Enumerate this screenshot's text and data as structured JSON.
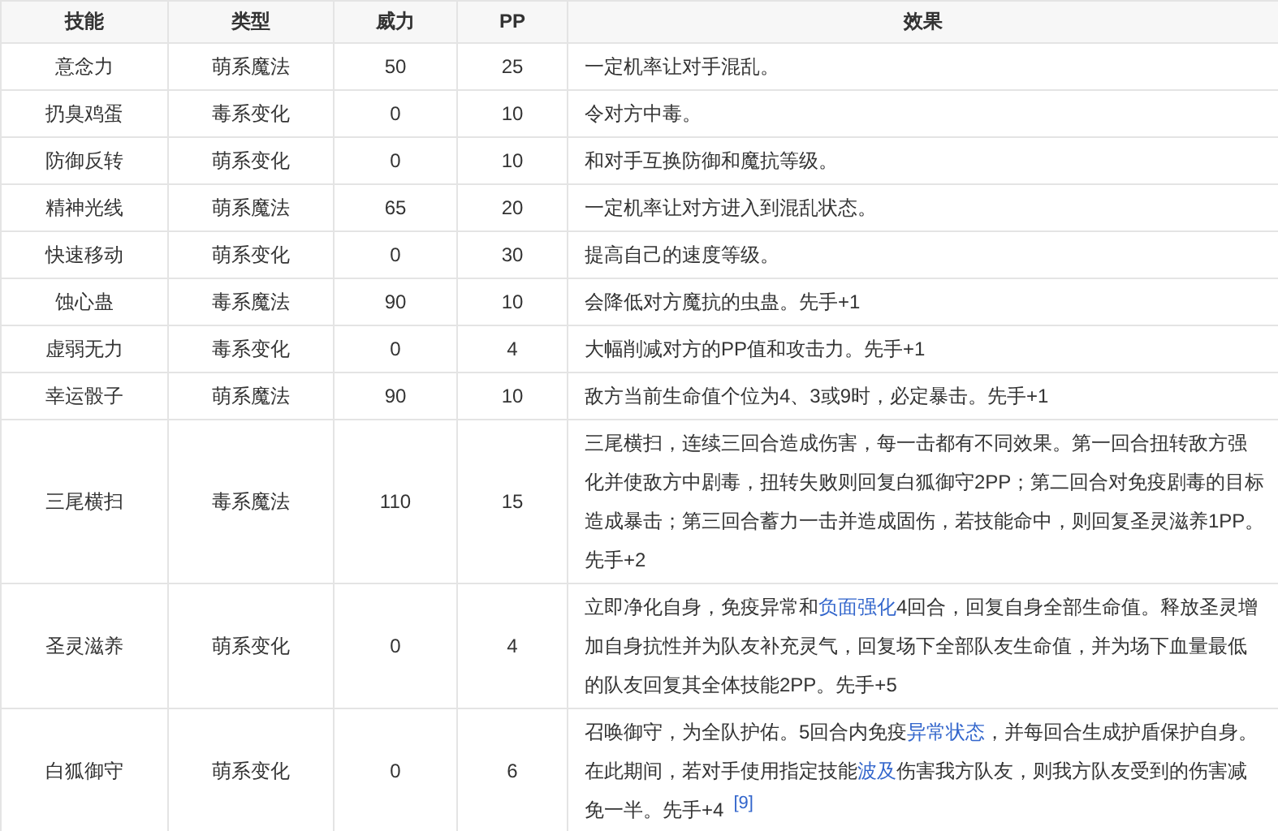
{
  "table": {
    "columns": [
      "技能",
      "类型",
      "威力",
      "PP",
      "效果"
    ],
    "rows": [
      {
        "cells": [
          "意念力",
          "萌系魔法",
          "50",
          "25"
        ],
        "effect": [
          {
            "kind": "text",
            "text": "一定机率让对手混乱。"
          }
        ]
      },
      {
        "cells": [
          "扔臭鸡蛋",
          "毒系变化",
          "0",
          "10"
        ],
        "effect": [
          {
            "kind": "text",
            "text": "令对方中毒。"
          }
        ]
      },
      {
        "cells": [
          "防御反转",
          "萌系变化",
          "0",
          "10"
        ],
        "effect": [
          {
            "kind": "text",
            "text": "和对手互换防御和魔抗等级。"
          }
        ]
      },
      {
        "cells": [
          "精神光线",
          "萌系魔法",
          "65",
          "20"
        ],
        "effect": [
          {
            "kind": "text",
            "text": "一定机率让对方进入到混乱状态。"
          }
        ]
      },
      {
        "cells": [
          "快速移动",
          "萌系变化",
          "0",
          "30"
        ],
        "effect": [
          {
            "kind": "text",
            "text": "提高自己的速度等级。"
          }
        ]
      },
      {
        "cells": [
          "蚀心蛊",
          "毒系魔法",
          "90",
          "10"
        ],
        "effect": [
          {
            "kind": "text",
            "text": "会降低对方魔抗的虫蛊。先手+1"
          }
        ]
      },
      {
        "cells": [
          "虚弱无力",
          "毒系变化",
          "0",
          "4"
        ],
        "effect": [
          {
            "kind": "text",
            "text": "大幅削减对方的PP值和攻击力。先手+1"
          }
        ]
      },
      {
        "cells": [
          "幸运骰子",
          "萌系魔法",
          "90",
          "10"
        ],
        "effect": [
          {
            "kind": "text",
            "text": "敌方当前生命值个位为4、3或9时，必定暴击。先手+1"
          }
        ]
      },
      {
        "cells": [
          "三尾横扫",
          "毒系魔法",
          "110",
          "15"
        ],
        "effect": [
          {
            "kind": "text",
            "text": "三尾横扫，连续三回合造成伤害，每一击都有不同效果。第一回合扭转敌方强化并使敌方中剧毒，扭转失败则回复白狐御守2PP；第二回合对免疫剧毒的目标造成暴击；第三回合蓄力一击并造成固伤，若技能命中，则回复圣灵滋养1PP。先手+2"
          }
        ]
      },
      {
        "cells": [
          "圣灵滋养",
          "萌系变化",
          "0",
          "4"
        ],
        "effect": [
          {
            "kind": "text",
            "text": "立即净化自身，免疫异常和"
          },
          {
            "kind": "link",
            "text": "负面强化"
          },
          {
            "kind": "text",
            "text": "4回合，回复自身全部生命值。释放圣灵增加自身抗性并为队友补充灵气，回复场下全部队友生命值，并为场下血量最低的队友回复其全体技能2PP。先手+5"
          }
        ]
      },
      {
        "cells": [
          "白狐御守",
          "萌系变化",
          "0",
          "6"
        ],
        "effect": [
          {
            "kind": "text",
            "text": "召唤御守，为全队护佑。5回合内免疫"
          },
          {
            "kind": "link",
            "text": "异常状态"
          },
          {
            "kind": "text",
            "text": "，并每回合生成护盾保护自身。在此期间，若对手使用指定技能"
          },
          {
            "kind": "link",
            "text": "波及"
          },
          {
            "kind": "text",
            "text": "伤害我方队友，则我方队友受到的伤害减免一半。先手+4"
          },
          {
            "kind": "ref",
            "text": "[9]"
          }
        ]
      }
    ]
  }
}
